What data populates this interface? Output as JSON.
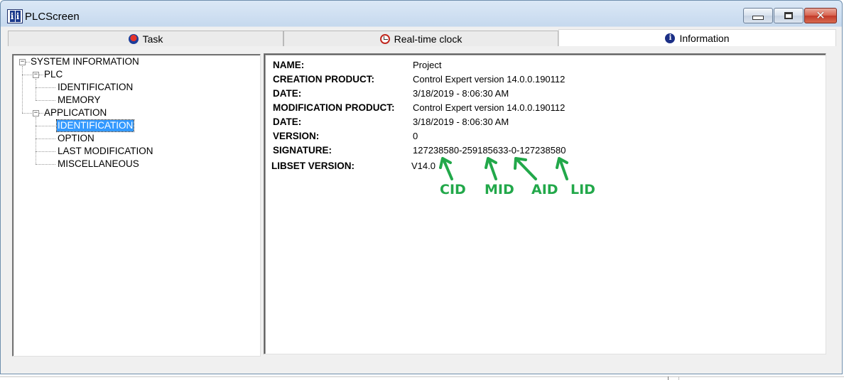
{
  "window": {
    "title": "PLCScreen",
    "close_glyph": "✕"
  },
  "tabs": [
    {
      "label": "Task",
      "icon": "task-icon",
      "active": false
    },
    {
      "label": "Real-time clock",
      "icon": "clock-icon",
      "active": false
    },
    {
      "label": "Information",
      "icon": "info-icon",
      "active": true
    }
  ],
  "tree": {
    "root": "SYSTEM INFORMATION",
    "plc": {
      "label": "PLC",
      "children": [
        "IDENTIFICATION",
        "MEMORY"
      ]
    },
    "application": {
      "label": "APPLICATION",
      "children": [
        "IDENTIFICATION",
        "OPTION",
        "LAST MODIFICATION",
        "MISCELLANEOUS"
      ],
      "selected": "IDENTIFICATION"
    }
  },
  "details": {
    "rows": [
      {
        "label": "NAME:",
        "value": "Project"
      },
      {
        "label": "CREATION PRODUCT:",
        "value": "Control Expert version 14.0.0.190112"
      },
      {
        "label": "DATE:",
        "value": "3/18/2019 - 8:06:30 AM"
      },
      {
        "label": "MODIFICATION PRODUCT:",
        "value": "Control Expert version 14.0.0.190112"
      },
      {
        "label": "DATE:",
        "value": "3/18/2019 - 8:06:30 AM"
      },
      {
        "label": "VERSION:",
        "value": "0"
      },
      {
        "label": "SIGNATURE:",
        "value": "127238580-259185633-0-127238580"
      },
      {
        "label": "LIBSET VERSION:",
        "value": "V14.0"
      }
    ]
  },
  "annotations": {
    "labels": [
      "CID",
      "MID",
      "AID",
      "LID"
    ],
    "color": "#22a84a"
  },
  "colors": {
    "selection": "#3399ff",
    "close_button": "#c2392a"
  }
}
